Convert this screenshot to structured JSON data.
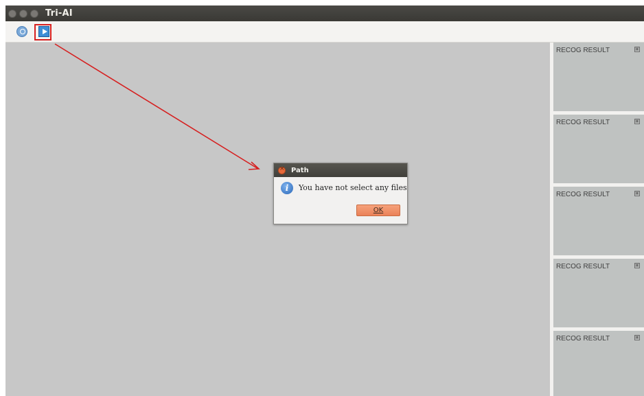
{
  "window": {
    "title": "Tri-AI"
  },
  "toolbar": {
    "items": [
      {
        "icon": "open-file-icon"
      },
      {
        "icon": "run-play-icon",
        "highlighted": true
      }
    ]
  },
  "panels": {
    "items": [
      {
        "title": "RECOG RESULT",
        "icon": "expand-icon"
      },
      {
        "title": "RECOG RESULT",
        "icon": "expand-icon"
      },
      {
        "title": "RECOG RESULT",
        "icon": "expand-icon"
      },
      {
        "title": "RECOG RESULT",
        "icon": "expand-icon"
      },
      {
        "title": "RECOG RESULT",
        "icon": "expand-icon"
      }
    ]
  },
  "dialog": {
    "title": "Path",
    "message": "You have not select any files",
    "ok_label": "OK",
    "icon": "info-icon"
  },
  "colors": {
    "annotation": "#d62020",
    "ok_button": "#ee8a62",
    "title_bar": "#3c3b37"
  }
}
